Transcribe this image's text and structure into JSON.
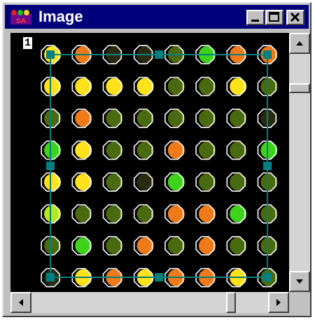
{
  "window": {
    "title": "Image",
    "icon": "sa-app-icon",
    "controls": [
      "minimize-icon",
      "maximize-icon",
      "close-icon"
    ]
  },
  "overlay": {
    "label": "1",
    "grid_color": "#008080",
    "circle_color": "#ffffff"
  },
  "array": {
    "rows": 8,
    "cols": 8,
    "spot_colors": {
      "y": "#ffe21a",
      "g": "#3fd21c",
      "o": "#f07a18",
      "r": "#d8321a",
      "l": "#b6e81e",
      "d": "#4a6a10",
      "k": "#2a2a10"
    },
    "spots": [
      [
        "y",
        "o",
        "k",
        "k",
        "d",
        "g",
        "o",
        "o"
      ],
      [
        "y",
        "y",
        "y",
        "y",
        "d",
        "d",
        "y",
        "d"
      ],
      [
        "d",
        "o",
        "d",
        "d",
        "d",
        "d",
        "d",
        "k"
      ],
      [
        "g",
        "y",
        "d",
        "d",
        "o",
        "d",
        "d",
        "g"
      ],
      [
        "y",
        "y",
        "d",
        "k",
        "g",
        "d",
        "d",
        "d"
      ],
      [
        "l",
        "d",
        "d",
        "d",
        "o",
        "o",
        "g",
        "d"
      ],
      [
        "d",
        "g",
        "d",
        "o",
        "d",
        "o",
        "d",
        "d"
      ],
      [
        "k",
        "y",
        "o",
        "y",
        "o",
        "o",
        "y",
        "d"
      ]
    ]
  },
  "scrollbars": {
    "vertical": {
      "up": "arrow-up-icon",
      "down": "arrow-down-icon"
    },
    "horizontal": {
      "left": "arrow-left-icon",
      "right": "arrow-right-icon"
    }
  }
}
